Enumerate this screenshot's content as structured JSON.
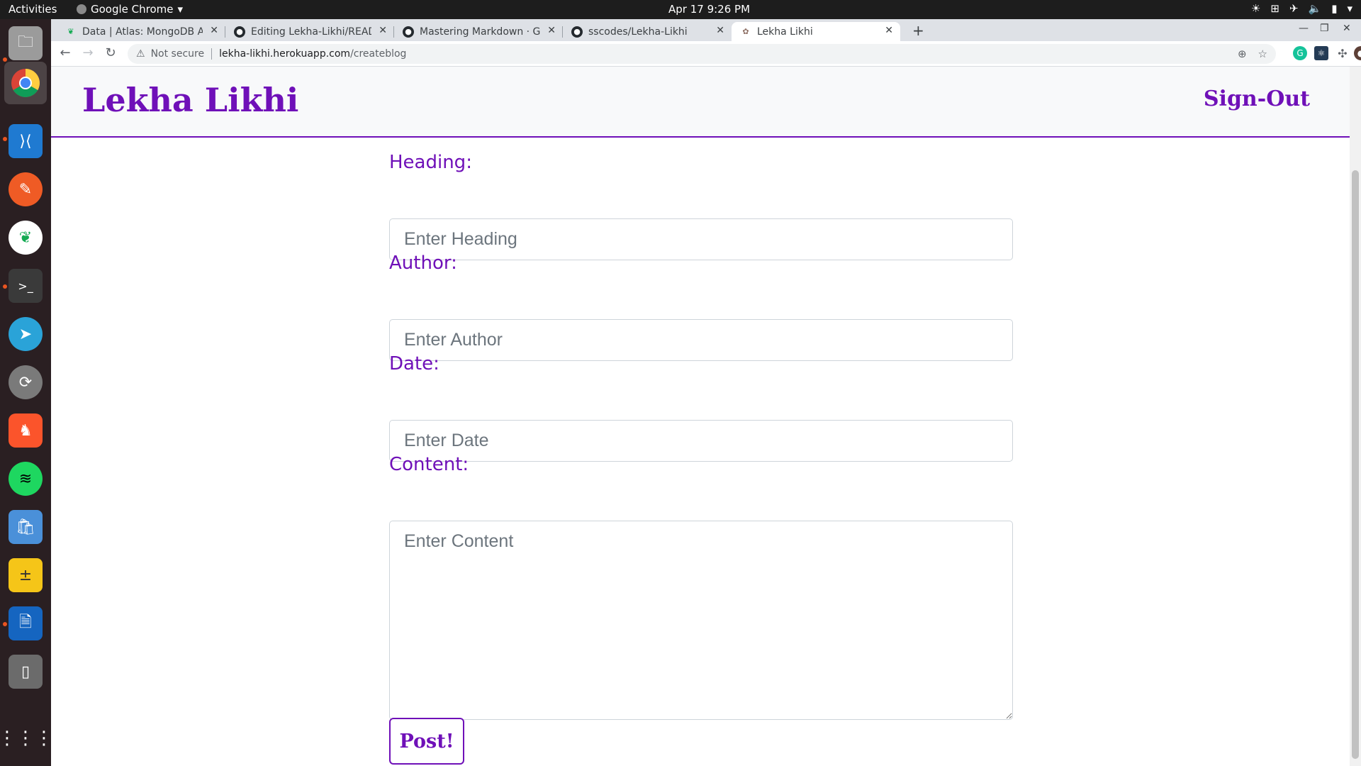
{
  "topbar": {
    "activities": "Activities",
    "app_name": "Google Chrome",
    "clock": "Apr 17  9:26 PM"
  },
  "browser": {
    "tabs": [
      {
        "title": "Data | Atlas: MongoDB At",
        "favicon": "mongodb-leaf-icon"
      },
      {
        "title": "Editing Lekha-Likhi/READ",
        "favicon": "github-icon"
      },
      {
        "title": "Mastering Markdown · Git",
        "favicon": "github-icon"
      },
      {
        "title": "sscodes/Lekha-Likhi",
        "favicon": "github-icon"
      },
      {
        "title": "Lekha Likhi",
        "favicon": "site-icon"
      }
    ],
    "address": {
      "security": "Not secure",
      "host": "lekha-likhi.herokuapp.com",
      "path": "/createblog"
    }
  },
  "site": {
    "brand": "Lekha Likhi",
    "signout": "Sign-Out",
    "accent": "#6f10b8"
  },
  "form": {
    "heading_label": "Heading:",
    "heading_placeholder": "Enter Heading",
    "author_label": "Author:",
    "author_placeholder": "Enter Author",
    "date_label": "Date:",
    "date_placeholder": "Enter Date",
    "content_label": "Content:",
    "content_placeholder": "Enter Content",
    "submit": "Post!"
  }
}
